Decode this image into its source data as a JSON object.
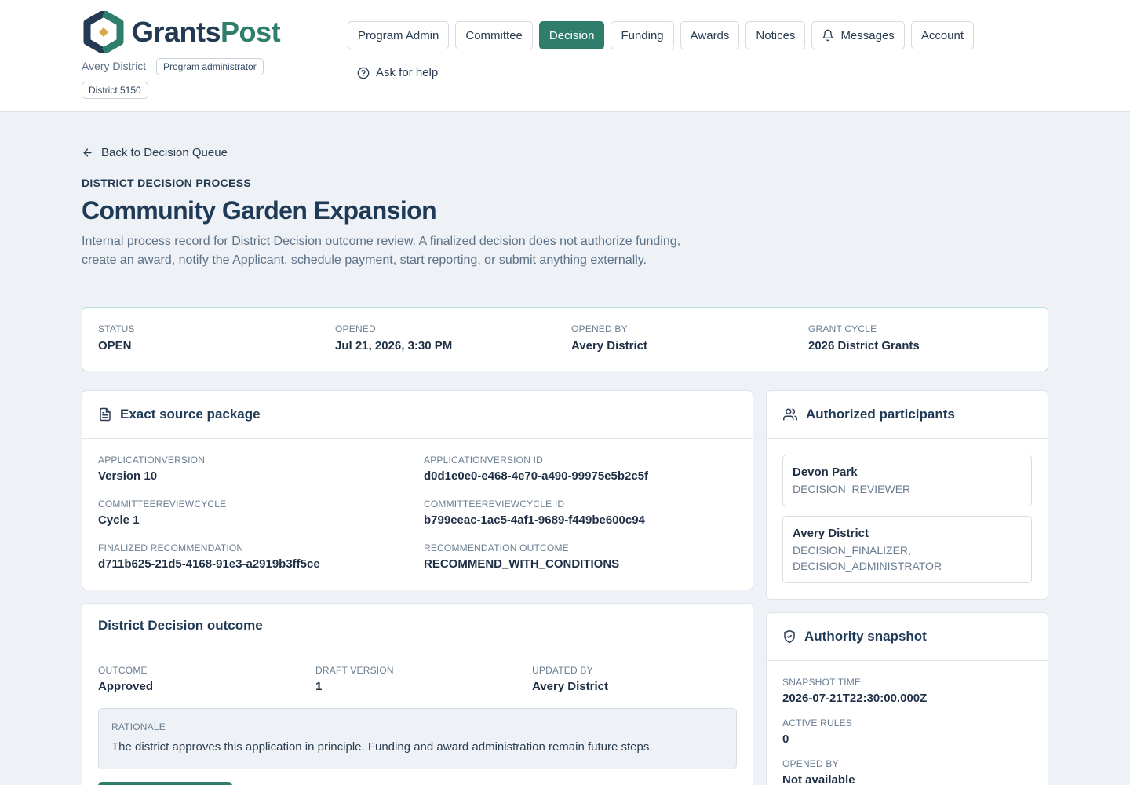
{
  "brand": {
    "part1": "Grants",
    "part2": "Post",
    "primary": "#2f7d6b",
    "navy": "#243a52"
  },
  "user": {
    "org": "Avery District",
    "role": "Program administrator",
    "district": "District 5150"
  },
  "nav": {
    "items": [
      "Program Admin",
      "Committee",
      "Decision",
      "Funding",
      "Awards",
      "Notices",
      "Messages",
      "Account"
    ],
    "active": "Decision",
    "help": "Ask for help"
  },
  "page": {
    "back": "Back to Decision Queue",
    "eyebrow": "DISTRICT DECISION PROCESS",
    "title": "Community Garden Expansion",
    "description": "Internal process record for District Decision outcome review. A finalized decision does not authorize funding, create an award, notify the Applicant, schedule payment, start reporting, or submit anything externally."
  },
  "summary": {
    "status_label": "STATUS",
    "status": "OPEN",
    "opened_label": "OPENED",
    "opened": "Jul 21, 2026, 3:30 PM",
    "opened_by_label": "OPENED BY",
    "opened_by": "Avery District",
    "cycle_label": "GRANT CYCLE",
    "cycle": "2026 District Grants"
  },
  "source": {
    "title": "Exact source package",
    "fields": [
      {
        "label": "APPLICATIONVERSION",
        "value": "Version 10"
      },
      {
        "label": "APPLICATIONVERSION ID",
        "value": "d0d1e0e0-e468-4e70-a490-99975e5b2c5f"
      },
      {
        "label": "COMMITTEEREVIEWCYCLE",
        "value": "Cycle 1"
      },
      {
        "label": "COMMITTEEREVIEWCYCLE ID",
        "value": "b799eeac-1ac5-4af1-9689-f449be600c94"
      },
      {
        "label": "FINALIZED RECOMMENDATION",
        "value": "d711b625-21d5-4168-91e3-a2919b3ff5ce"
      },
      {
        "label": "RECOMMENDATION OUTCOME",
        "value": "RECOMMEND_WITH_CONDITIONS"
      }
    ]
  },
  "outcome": {
    "title": "District Decision outcome",
    "outcome_label": "OUTCOME",
    "outcome": "Approved",
    "draft_label": "DRAFT VERSION",
    "draft": "1",
    "updated_label": "UPDATED BY",
    "updated": "Avery District",
    "rationale_label": "RATIONALE",
    "rationale": "The district approves this application in principle. Funding and award administration remain future steps."
  },
  "participants": {
    "title": "Authorized participants",
    "items": [
      {
        "name": "Devon Park",
        "role": "DECISION_REVIEWER"
      },
      {
        "name": "Avery District",
        "role": "DECISION_FINALIZER, DECISION_ADMINISTRATOR"
      }
    ]
  },
  "authority": {
    "title": "Authority snapshot",
    "snapshot_label": "SNAPSHOT TIME",
    "snapshot": "2026-07-21T22:30:00.000Z",
    "rules_label": "ACTIVE RULES",
    "rules": "0",
    "opened_by_label": "OPENED BY",
    "opened_by": "Not available"
  }
}
